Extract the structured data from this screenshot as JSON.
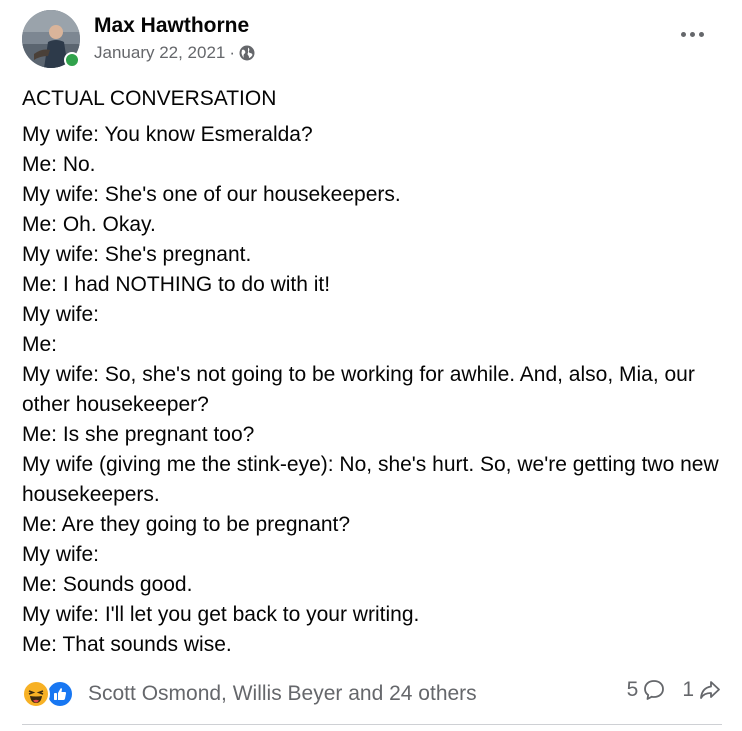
{
  "post": {
    "author": "Max Hawthorne",
    "date": "January 22, 2021",
    "separator": "·",
    "audience_icon": "globe-icon",
    "more_icon": "more-horizontal-icon",
    "title": "ACTUAL CONVERSATION",
    "lines": [
      "My wife: You know Esmeralda?",
      "Me: No.",
      "My wife: She's one of our housekeepers.",
      "Me: Oh. Okay.",
      "My wife: She's pregnant.",
      "Me: I had NOTHING to do with it!",
      "My wife:",
      "Me:",
      "My wife: So, she's not going to be working for awhile. And, also, Mia, our other housekeeper?",
      "Me: Is she pregnant too?",
      "My wife (giving me the stink-eye): No, she's hurt. So, we're getting two new housekeepers.",
      "Me: Are they going to be pregnant?",
      "My wife:",
      "Me: Sounds good.",
      "My wife: I'll let you get back to your writing.",
      "Me: That sounds wise."
    ]
  },
  "footer": {
    "reaction_icons": [
      "haha-icon",
      "like-icon"
    ],
    "reactors": "Scott Osmond, Willis Beyer and 24 others",
    "comments_count": "5",
    "shares_count": "1",
    "comment_icon": "comment-icon",
    "share_icon": "share-icon"
  },
  "colors": {
    "online": "#31a24c",
    "like": "#1877f2",
    "haha": "#f7b125",
    "secondary_text": "#65676b"
  }
}
